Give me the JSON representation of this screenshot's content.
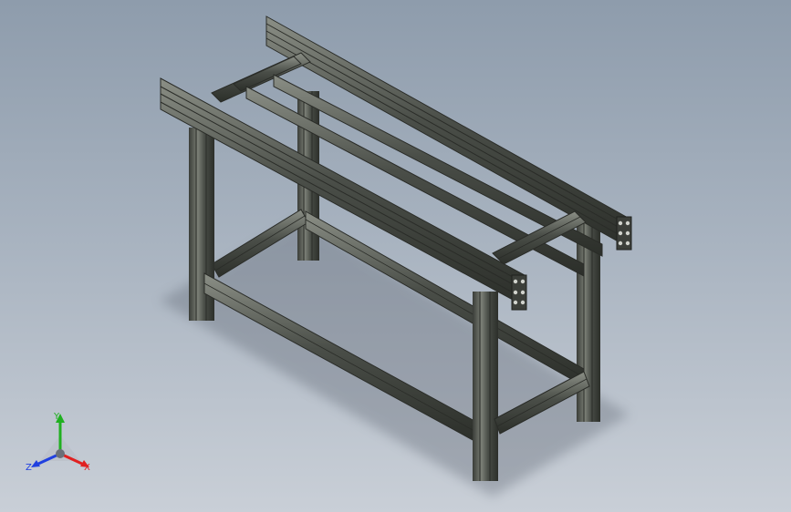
{
  "viewport": {
    "background_top": "#8e9cac",
    "background_bottom": "#c9cfd7"
  },
  "model": {
    "profile_color": "#4a4e48",
    "profile_dark": "#2c2f2a",
    "profile_light": "#8b8f86"
  },
  "triad": {
    "icon": "coordinate-triad-icon",
    "x_label": "X",
    "y_label": "Y",
    "z_label": "Z",
    "x_color": "#e02020",
    "y_color": "#20b020",
    "z_color": "#2040e0"
  }
}
